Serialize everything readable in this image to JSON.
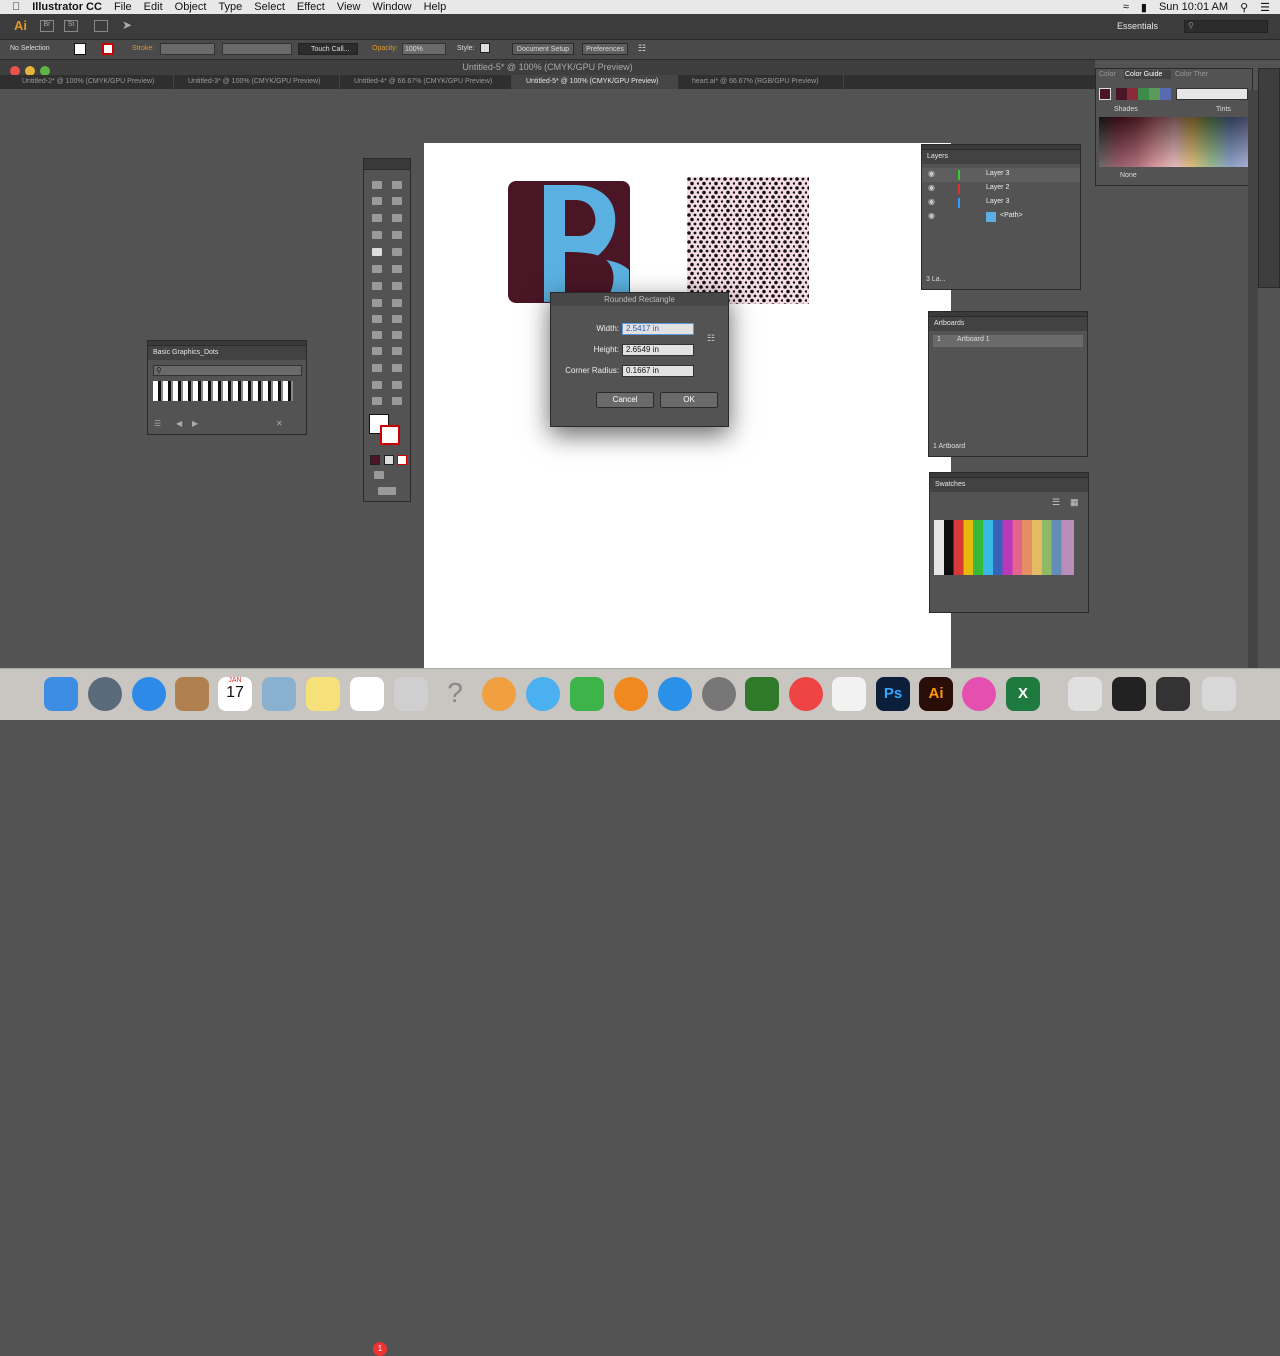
{
  "menubar": {
    "app_name": "Illustrator CC",
    "items": [
      "File",
      "Edit",
      "Object",
      "Type",
      "Select",
      "Effect",
      "View",
      "Window",
      "Help"
    ],
    "clock": "Sun 10:01 AM"
  },
  "appbar": {
    "logo": "Ai",
    "workspace": "Essentials"
  },
  "controlbar": {
    "selection": "No Selection",
    "stroke_label": "Stroke:",
    "brush": "Touch Call...",
    "opacity_label": "Opacity:",
    "opacity_value": "100%",
    "style_label": "Style:",
    "document_setup": "Document Setup",
    "preferences": "Preferences"
  },
  "window": {
    "title": "Untitled-5* @ 100% (CMYK/GPU Preview)"
  },
  "tabs": [
    {
      "label": "Untitled-2* @ 100% (CMYK/GPU Preview)"
    },
    {
      "label": "Untitled-3* @ 100% (CMYK/GPU Preview)"
    },
    {
      "label": "Untitled-4* @ 66.67% (CMYK/GPU Preview)"
    },
    {
      "label": "Untitled-5* @ 100% (CMYK/GPU Preview)"
    },
    {
      "label": "heart.ai* @ 66.67% (RGB/GPU Preview)"
    }
  ],
  "dialog": {
    "title": "Rounded Rectangle",
    "width_label": "Width:",
    "width_value": "2.5417 in",
    "height_label": "Height:",
    "height_value": "2.6549 in",
    "radius_label": "Corner Radius:",
    "radius_value": "0.1667 in",
    "cancel": "Cancel",
    "ok": "OK"
  },
  "basic_graphics": {
    "title": "Basic Graphics_Dots"
  },
  "color_guide": {
    "tab1": "Color",
    "tab2": "Color Guide",
    "tab3": "Color Ther",
    "shades": "Shades",
    "tints": "Tints",
    "none_label": "None"
  },
  "layers": {
    "title": "Layers",
    "rows": [
      {
        "name": "Layer 3"
      },
      {
        "name": "Layer 2"
      },
      {
        "name": "Layer 3"
      },
      {
        "name": "<Path>"
      }
    ],
    "footer": "3 La..."
  },
  "artboards": {
    "title": "Artboards",
    "row_num": "1",
    "row_name": "Artboard 1",
    "footer": "1 Artboard"
  },
  "swatches": {
    "title": "Swatches"
  },
  "dock": {
    "calendar_month": "JAN",
    "calendar_day": "17",
    "badge": "1"
  },
  "colors": {
    "artwork_maroon": "#4a1626",
    "artwork_blue": "#5ab0e0",
    "ui_dark": "#535353"
  }
}
